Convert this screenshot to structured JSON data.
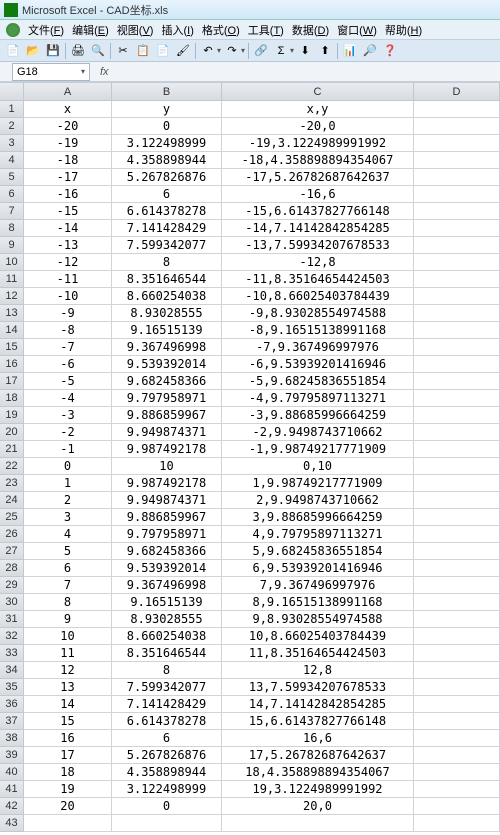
{
  "window": {
    "app": "Microsoft Excel",
    "file": "CAD坐标.xls"
  },
  "menus": [
    {
      "label": "文件",
      "key": "F"
    },
    {
      "label": "编辑",
      "key": "E"
    },
    {
      "label": "视图",
      "key": "V"
    },
    {
      "label": "插入",
      "key": "I"
    },
    {
      "label": "格式",
      "key": "O"
    },
    {
      "label": "工具",
      "key": "T"
    },
    {
      "label": "数据",
      "key": "D"
    },
    {
      "label": "窗口",
      "key": "W"
    },
    {
      "label": "帮助",
      "key": "H"
    }
  ],
  "toolbar_icons": [
    "new-doc",
    "open",
    "save",
    "sep",
    "print",
    "preview",
    "sep",
    "spell",
    "research",
    "sep",
    "cut",
    "copy",
    "paste",
    "format-painter",
    "sep",
    "undo",
    "redo",
    "sep",
    "link",
    "sep",
    "sum",
    "sort-asc",
    "sort-desc",
    "sep",
    "chart",
    "drawing",
    "zoom",
    "help"
  ],
  "name_box": "G18",
  "formula_label": "fx",
  "columns": [
    "A",
    "B",
    "C",
    "D"
  ],
  "rows": [
    {
      "n": 1,
      "A": "x",
      "B": "y",
      "C": "x,y",
      "D": ""
    },
    {
      "n": 2,
      "A": "-20",
      "B": "0",
      "C": "-20,0",
      "D": ""
    },
    {
      "n": 3,
      "A": "-19",
      "B": "3.122498999",
      "C": "-19,3.1224989991992",
      "D": ""
    },
    {
      "n": 4,
      "A": "-18",
      "B": "4.358898944",
      "C": "-18,4.358898894354067",
      "D": ""
    },
    {
      "n": 5,
      "A": "-17",
      "B": "5.267826876",
      "C": "-17,5.26782687642637",
      "D": ""
    },
    {
      "n": 6,
      "A": "-16",
      "B": "6",
      "C": "-16,6",
      "D": ""
    },
    {
      "n": 7,
      "A": "-15",
      "B": "6.614378278",
      "C": "-15,6.61437827766148",
      "D": ""
    },
    {
      "n": 8,
      "A": "-14",
      "B": "7.141428429",
      "C": "-14,7.14142842854285",
      "D": ""
    },
    {
      "n": 9,
      "A": "-13",
      "B": "7.599342077",
      "C": "-13,7.59934207678533",
      "D": ""
    },
    {
      "n": 10,
      "A": "-12",
      "B": "8",
      "C": "-12,8",
      "D": ""
    },
    {
      "n": 11,
      "A": "-11",
      "B": "8.351646544",
      "C": "-11,8.35164654424503",
      "D": ""
    },
    {
      "n": 12,
      "A": "-10",
      "B": "8.660254038",
      "C": "-10,8.66025403784439",
      "D": ""
    },
    {
      "n": 13,
      "A": "-9",
      "B": "8.93028555",
      "C": "-9,8.93028554974588",
      "D": ""
    },
    {
      "n": 14,
      "A": "-8",
      "B": "9.16515139",
      "C": "-8,9.16515138991168",
      "D": ""
    },
    {
      "n": 15,
      "A": "-7",
      "B": "9.367496998",
      "C": "-7,9.367496997976",
      "D": ""
    },
    {
      "n": 16,
      "A": "-6",
      "B": "9.539392014",
      "C": "-6,9.53939201416946",
      "D": ""
    },
    {
      "n": 17,
      "A": "-5",
      "B": "9.682458366",
      "C": "-5,9.68245836551854",
      "D": ""
    },
    {
      "n": 18,
      "A": "-4",
      "B": "9.797958971",
      "C": "-4,9.79795897113271",
      "D": ""
    },
    {
      "n": 19,
      "A": "-3",
      "B": "9.886859967",
      "C": "-3,9.88685996664259",
      "D": ""
    },
    {
      "n": 20,
      "A": "-2",
      "B": "9.949874371",
      "C": "-2,9.9498743710662",
      "D": ""
    },
    {
      "n": 21,
      "A": "-1",
      "B": "9.987492178",
      "C": "-1,9.98749217771909",
      "D": ""
    },
    {
      "n": 22,
      "A": "0",
      "B": "10",
      "C": "0,10",
      "D": ""
    },
    {
      "n": 23,
      "A": "1",
      "B": "9.987492178",
      "C": "1,9.98749217771909",
      "D": ""
    },
    {
      "n": 24,
      "A": "2",
      "B": "9.949874371",
      "C": "2,9.9498743710662",
      "D": ""
    },
    {
      "n": 25,
      "A": "3",
      "B": "9.886859967",
      "C": "3,9.88685996664259",
      "D": ""
    },
    {
      "n": 26,
      "A": "4",
      "B": "9.797958971",
      "C": "4,9.79795897113271",
      "D": ""
    },
    {
      "n": 27,
      "A": "5",
      "B": "9.682458366",
      "C": "5,9.68245836551854",
      "D": ""
    },
    {
      "n": 28,
      "A": "6",
      "B": "9.539392014",
      "C": "6,9.53939201416946",
      "D": ""
    },
    {
      "n": 29,
      "A": "7",
      "B": "9.367496998",
      "C": "7,9.367496997976",
      "D": ""
    },
    {
      "n": 30,
      "A": "8",
      "B": "9.16515139",
      "C": "8,9.16515138991168",
      "D": ""
    },
    {
      "n": 31,
      "A": "9",
      "B": "8.93028555",
      "C": "9,8.93028554974588",
      "D": ""
    },
    {
      "n": 32,
      "A": "10",
      "B": "8.660254038",
      "C": "10,8.66025403784439",
      "D": ""
    },
    {
      "n": 33,
      "A": "11",
      "B": "8.351646544",
      "C": "11,8.35164654424503",
      "D": ""
    },
    {
      "n": 34,
      "A": "12",
      "B": "8",
      "C": "12,8",
      "D": ""
    },
    {
      "n": 35,
      "A": "13",
      "B": "7.599342077",
      "C": "13,7.59934207678533",
      "D": ""
    },
    {
      "n": 36,
      "A": "14",
      "B": "7.141428429",
      "C": "14,7.14142842854285",
      "D": ""
    },
    {
      "n": 37,
      "A": "15",
      "B": "6.614378278",
      "C": "15,6.61437827766148",
      "D": ""
    },
    {
      "n": 38,
      "A": "16",
      "B": "6",
      "C": "16,6",
      "D": ""
    },
    {
      "n": 39,
      "A": "17",
      "B": "5.267826876",
      "C": "17,5.26782687642637",
      "D": ""
    },
    {
      "n": 40,
      "A": "18",
      "B": "4.358898944",
      "C": "18,4.358898894354067",
      "D": ""
    },
    {
      "n": 41,
      "A": "19",
      "B": "3.122498999",
      "C": "19,3.1224989991992",
      "D": ""
    },
    {
      "n": 42,
      "A": "20",
      "B": "0",
      "C": "20,0",
      "D": ""
    },
    {
      "n": 43,
      "A": "",
      "B": "",
      "C": "",
      "D": ""
    }
  ]
}
